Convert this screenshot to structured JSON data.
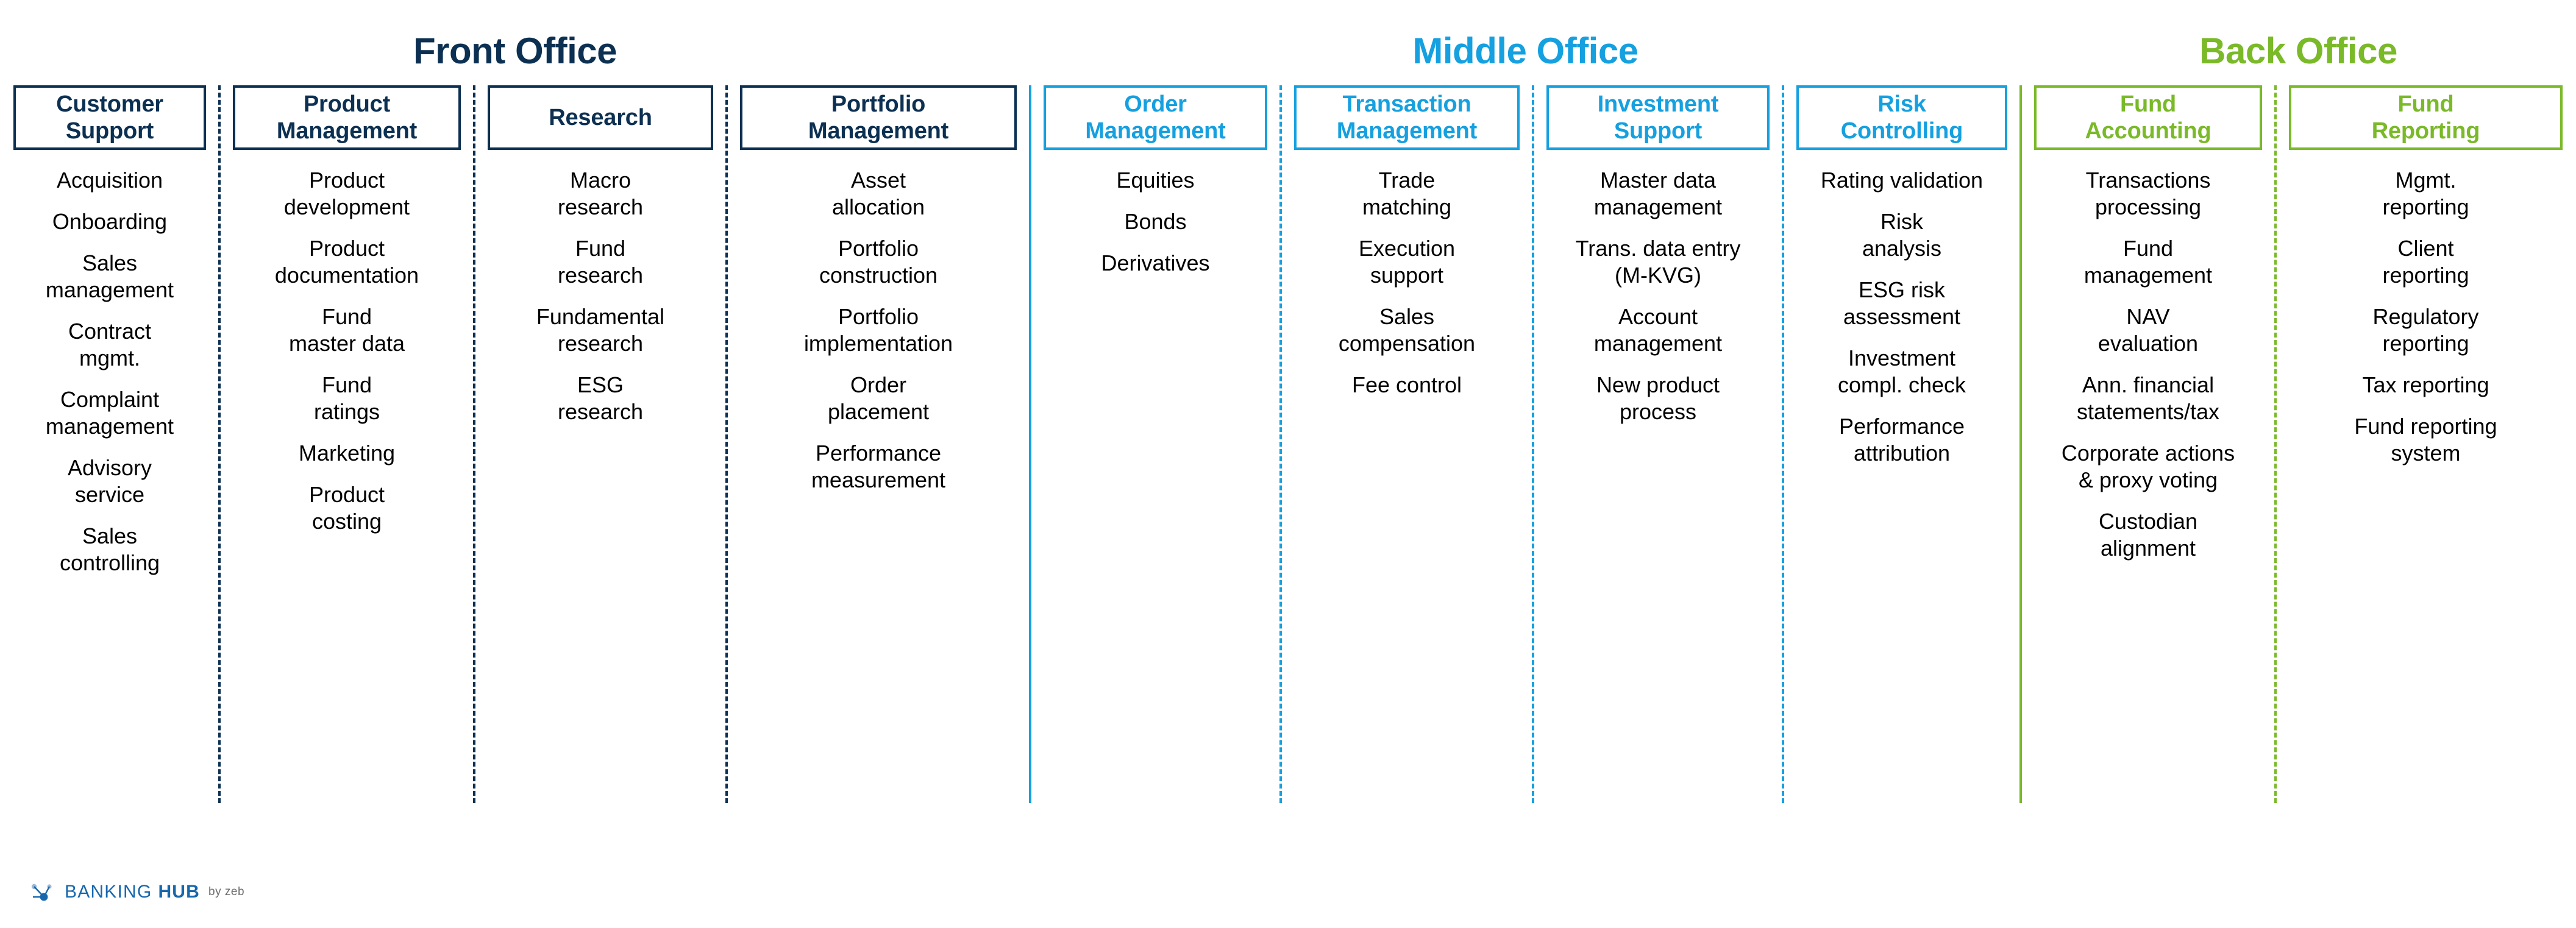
{
  "colors": {
    "front_office": "#0c3052",
    "middle_office": "#15a0e0",
    "back_office": "#7ab928",
    "item_text": "#000000",
    "logo_blue": "#1767ad",
    "logo_grey": "#6b6b6b",
    "background": "#ffffff"
  },
  "sections": [
    {
      "id": "front-office",
      "title": "Front Office",
      "columns": [
        {
          "id": "customer-support",
          "header": "Customer\nSupport",
          "items": [
            "Acquisition",
            "Onboarding",
            "Sales\nmanagement",
            "Contract\nmgmt.",
            "Complaint\nmanagement",
            "Advisory\nservice",
            "Sales\ncontrolling"
          ]
        },
        {
          "id": "product-management",
          "header": "Product\nManagement",
          "items": [
            "Product\ndevelopment",
            "Product\ndocumentation",
            "Fund\nmaster data",
            "Fund\nratings",
            "Marketing",
            "Product\ncosting"
          ]
        },
        {
          "id": "research",
          "header": "Research",
          "items": [
            "Macro\nresearch",
            "Fund\nresearch",
            "Fundamental\nresearch",
            "ESG\nresearch"
          ]
        },
        {
          "id": "portfolio-management",
          "header": "Portfolio\nManagement",
          "items": [
            "Asset\nallocation",
            "Portfolio\nconstruction",
            "Portfolio\nimplementation",
            "Order\nplacement",
            "Performance\nmeasurement"
          ]
        }
      ]
    },
    {
      "id": "middle-office",
      "title": "Middle Office",
      "columns": [
        {
          "id": "order-management",
          "header": "Order\nManagement",
          "items": [
            "Equities",
            "Bonds",
            "Derivatives"
          ]
        },
        {
          "id": "transaction-management",
          "header": "Transaction\nManagement",
          "items": [
            "Trade\nmatching",
            "Execution\nsupport",
            "Sales\ncompensation",
            "Fee control"
          ]
        },
        {
          "id": "investment-support",
          "header": "Investment\nSupport",
          "items": [
            "Master data\nmanagement",
            "Trans. data entry\n(M-KVG)",
            "Account\nmanagement",
            "New product\nprocess"
          ]
        },
        {
          "id": "risk-controlling",
          "header": "Risk\nControlling",
          "items": [
            "Rating validation",
            "Risk\nanalysis",
            "ESG risk\nassessment",
            "Investment\ncompl. check",
            "Performance\nattribution"
          ]
        }
      ]
    },
    {
      "id": "back-office",
      "title": "Back Office",
      "columns": [
        {
          "id": "fund-accounting",
          "header": "Fund\nAccounting",
          "items": [
            "Transactions\nprocessing",
            "Fund\nmanagement",
            "NAV\nevaluation",
            "Ann. financial\nstatements/tax",
            "Corporate actions\n& proxy voting",
            "Custodian\nalignment"
          ]
        },
        {
          "id": "fund-reporting",
          "header": "Fund\nReporting",
          "items": [
            "Mgmt.\nreporting",
            "Client\nreporting",
            "Regulatory\nreporting",
            "Tax reporting",
            "Fund reporting\nsystem"
          ]
        }
      ]
    }
  ],
  "footer": {
    "icon": "network-node-icon",
    "brand_primary": "BANKING",
    "brand_secondary": "HUB",
    "brand_suffix": "by zeb"
  }
}
